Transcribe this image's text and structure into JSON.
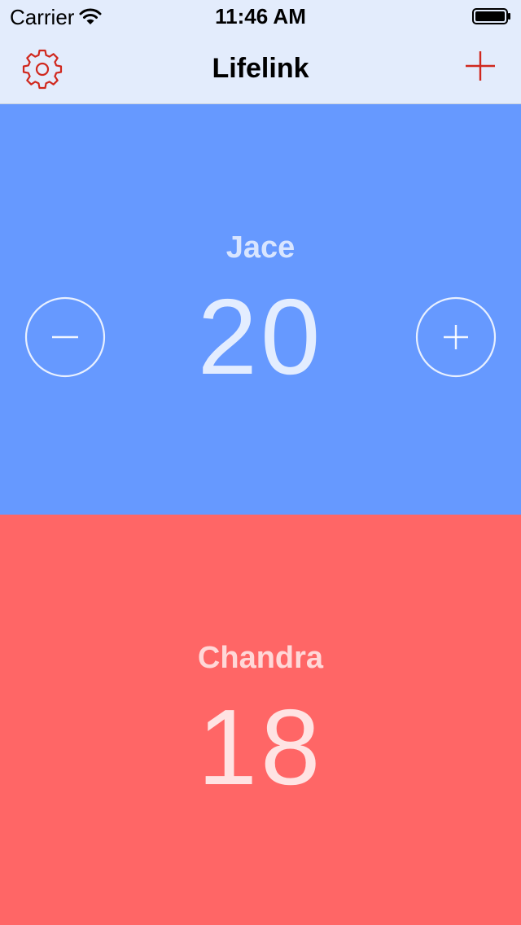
{
  "status_bar": {
    "carrier": "Carrier",
    "time": "11:46 AM",
    "wifi_icon": "wifi-icon",
    "battery_icon": "battery-icon"
  },
  "nav_bar": {
    "title": "Lifelink",
    "settings_icon": "gear-icon",
    "add_icon": "plus-icon",
    "accent_color": "#d0281e"
  },
  "players": [
    {
      "name": "Jace",
      "life": "20",
      "color": "#6699ff",
      "decrement_icon": "minus-circle-icon",
      "increment_icon": "plus-circle-icon"
    },
    {
      "name": "Chandra",
      "life": "18",
      "color": "#ff6666"
    }
  ]
}
